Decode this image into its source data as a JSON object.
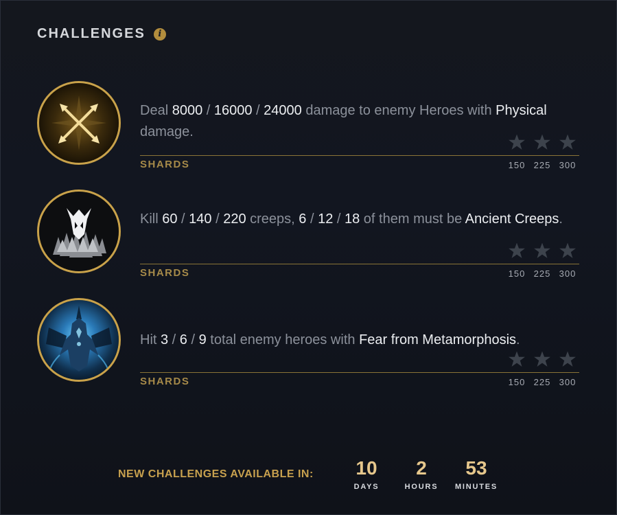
{
  "header": {
    "title": "CHALLENGES",
    "info_glyph": "i"
  },
  "colors": {
    "accent_gold": "#c9a24a",
    "highlight_text": "#eceef1",
    "muted_text": "#8c919b",
    "star_inactive": "#3d434c"
  },
  "challenges": [
    {
      "icon": "crossed-arrows-icon",
      "parts": [
        "Deal ",
        "8000",
        " / ",
        "16000",
        " / ",
        "24000",
        " damage to enemy Heroes with ",
        "Physical",
        " damage."
      ],
      "shards_label": "SHARDS",
      "rewards": [
        "150",
        "225",
        "300"
      ],
      "stars_earned": 0
    },
    {
      "icon": "ancient-creeps-icon",
      "parts": [
        "Kill ",
        "60",
        " / ",
        "140",
        " / ",
        "220",
        " creeps, ",
        "6",
        " / ",
        "12",
        " / ",
        "18",
        " of them must be ",
        "Ancient Creeps",
        "."
      ],
      "shards_label": "SHARDS",
      "rewards": [
        "150",
        "225",
        "300"
      ],
      "stars_earned": 0
    },
    {
      "icon": "terrorblade-metamorphosis-icon",
      "parts": [
        "Hit ",
        "3",
        " / ",
        "6",
        " / ",
        "9",
        " total enemy heroes with ",
        "Fear from Metamorphosis",
        "."
      ],
      "shards_label": "SHARDS",
      "rewards": [
        "150",
        "225",
        "300"
      ],
      "stars_earned": 0
    }
  ],
  "footer": {
    "label": "NEW CHALLENGES AVAILABLE IN:",
    "days": "10",
    "days_label": "DAYS",
    "hours": "2",
    "hours_label": "HOURS",
    "minutes": "53",
    "minutes_label": "MINUTES"
  }
}
